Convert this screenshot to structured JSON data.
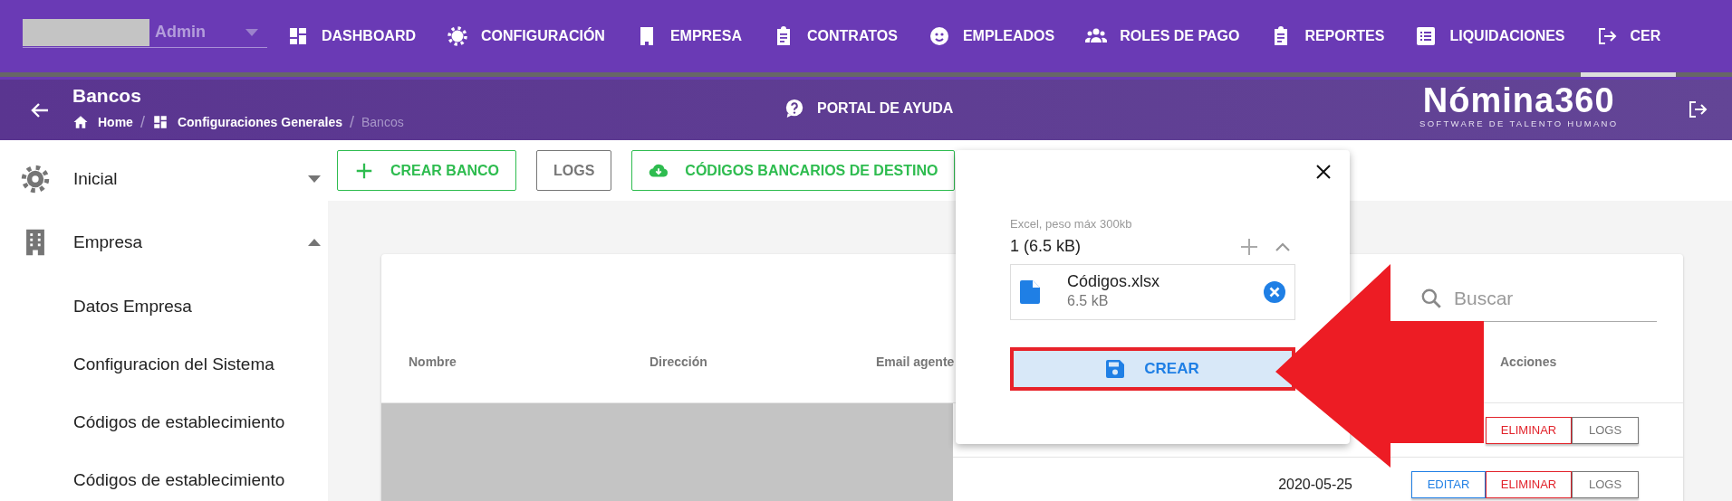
{
  "user_menu": {
    "label": "Admin"
  },
  "nav_items": [
    {
      "label": "DASHBOARD",
      "selected": false
    },
    {
      "label": "CONFIGURACIÓN",
      "selected": false
    },
    {
      "label": "EMPRESA",
      "selected": false
    },
    {
      "label": "CONTRATOS",
      "selected": false
    },
    {
      "label": "EMPLEADOS",
      "selected": false
    },
    {
      "label": "ROLES DE PAGO",
      "selected": false
    },
    {
      "label": "REPORTES",
      "selected": false
    },
    {
      "label": "LIQUIDACIONES",
      "selected": false
    },
    {
      "label": "CER",
      "selected": true
    }
  ],
  "header": {
    "title": "Bancos",
    "breadcrumb": [
      {
        "label": "Home"
      },
      {
        "separator": "/",
        "label": "Configuraciones Generales"
      },
      {
        "separator": "/",
        "label": "Bancos"
      }
    ],
    "help_link": "PORTAL DE AYUDA",
    "logo": {
      "name": "Nómina360",
      "tagline": "SOFTWARE DE TALENTO HUMANO"
    }
  },
  "sidebar": {
    "items": [
      {
        "label": "Inicial",
        "expanded": false
      },
      {
        "label": "Empresa",
        "expanded": true,
        "children": [
          {
            "label": "Datos Empresa"
          },
          {
            "label": "Configuracion del Sistema"
          },
          {
            "label": "Códigos de establecimiento"
          },
          {
            "label": "Códigos de establecimiento"
          }
        ]
      }
    ]
  },
  "toolbar": [
    {
      "label": "CREAR BANCO",
      "kind": "success"
    },
    {
      "label": "LOGS",
      "kind": "secondary"
    },
    {
      "label": "CÓDIGOS BANCARIOS DE DESTINO",
      "kind": "success"
    }
  ],
  "table": {
    "search": {
      "placeholder": "Buscar"
    },
    "columns": [
      "Nombre",
      "Dirección",
      "Email agente",
      "Acciones"
    ],
    "rows": [
      {
        "actions": [
          {
            "label": "ELIMINAR",
            "kind": "danger"
          },
          {
            "label": "LOGS",
            "kind": "secondary"
          }
        ]
      },
      {
        "date": "2020-05-25",
        "actions": [
          {
            "label": "EDITAR",
            "kind": "primary"
          },
          {
            "label": "ELIMINAR",
            "kind": "danger"
          },
          {
            "label": "LOGS",
            "kind": "secondary"
          }
        ]
      }
    ]
  },
  "upload_dialog": {
    "hint": "Excel, peso máx 300kb",
    "summary": "1 (6.5 kB)",
    "files": [
      {
        "name": "Códigos.xlsx",
        "size": "6.5 kB"
      }
    ],
    "submit": "CREAR"
  }
}
